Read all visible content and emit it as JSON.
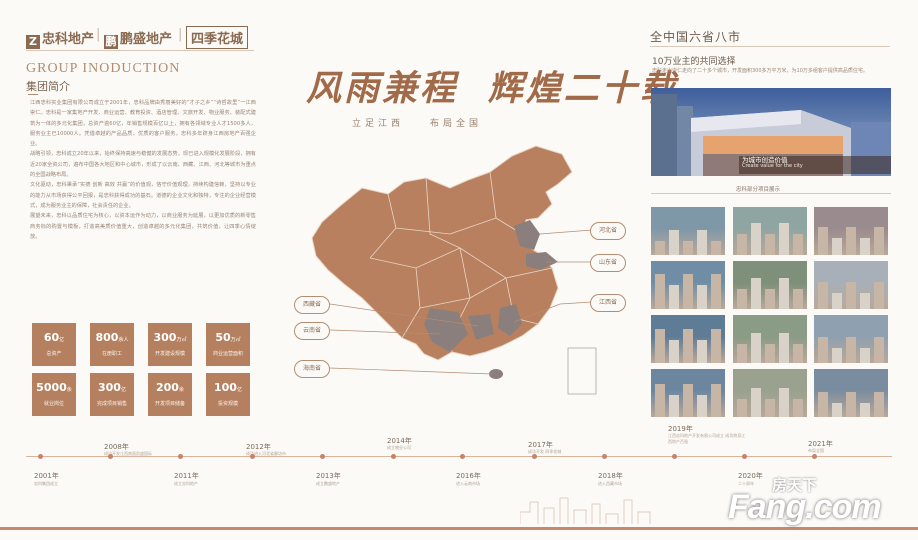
{
  "header": {
    "logos": [
      {
        "mark": "Z",
        "name": "忠科地产"
      },
      {
        "mark": "鹏",
        "name": "鹏盛地产"
      },
      {
        "mark": "",
        "name": "四季花城"
      }
    ]
  },
  "intro": {
    "title_en": "GROUP INODUCTION",
    "title_cn": "集团简介",
    "paragraphs": [
      "江西忠科实业集团有限公司成立于2001年，忠科品牌由秀丽美好的“才子之乡”“诗哲故里”一江西崇仁。忠科是一家集地产开发、商业运营、教育投资、酒店管理、文旅开发、物业服务、装配式建筑为一体的多元化集团，总资产逾60亿，年销售规模百亿以上，拥有各领域专业人才1500多人，服务业主已10000人。凭借卓越的产品品质、优质的客户服务，忠科多年跻身江西房地产百强企业。",
      "战略引领，忠科成立20年以来，始终保持高速与稳健的发展态势，现已进入规模化发展阶段，拥有近20家全资公司，遍布中国各大地区和中心城市，形成了以云南、西藏、江西、河北等城市为重点的全国战略布局。",
      "文化驱动，忠科秉承“实德 创新 高效 共赢”的价值观，恪守价值观理，持续构建信赖，坚持以专业的能力从市场获得公平回报，是忠科获得成功的基石。道德的企业文化和独特，专注的企业经营模式，成为服务业主的保障，社会责任的企业。",
      "展望未来，忠科以品质住宅为核心，以资本运作为动力，以商业服务为延展，以更加优质的新零售商务标的购置与模板，打造高美质价值重大，创造卓越的多元化集团，共筑价值，让四季心情绽放。"
    ],
    "stats": [
      {
        "num": "60",
        "unit": "亿",
        "label": "总资产"
      },
      {
        "num": "800",
        "unit": "余人",
        "label": "在册职工"
      },
      {
        "num": "300",
        "unit": "万㎡",
        "label": "开发建设规模"
      },
      {
        "num": "50",
        "unit": "万㎡",
        "label": "商业运营面积"
      },
      {
        "num": "5000",
        "unit": "余",
        "label": "就业岗位"
      },
      {
        "num": "300",
        "unit": "亿",
        "label": "完成项目销售"
      },
      {
        "num": "200",
        "unit": "余",
        "label": "开发项目储备"
      },
      {
        "num": "100",
        "unit": "亿",
        "label": "投资规模"
      }
    ]
  },
  "center": {
    "slogan_part1": "风雨兼程",
    "slogan_part2": "辉煌二十载",
    "subslogan": "立足江西　　布局全国",
    "provinces": {
      "hebei": "河北省",
      "shandong": "山东省",
      "jiangxi": "江西省",
      "xizang": "西藏省",
      "yunnan": "云南省",
      "hainan": "海南省"
    }
  },
  "right": {
    "title": "全中国六省八市",
    "subtitle": "10万业主的共同选择",
    "desc": "忠科走出崇仁走向了二十多个城市，开发面积300多万平方米，为10万多组客户提供高品质住宅。",
    "photo_caption_cn": "为城市创造价值",
    "photo_caption_en": "Create value for the city",
    "gallery_caption": "忠科部分项目展示",
    "thumb_colors": [
      "#7f98a8",
      "#8fa5a2",
      "#9a8b8e",
      "#6f8ea6",
      "#7e8f7a",
      "#a7b0b8",
      "#5f7c96",
      "#8a9b86",
      "#8fa0b0",
      "#6d86a0",
      "#9aa18f",
      "#7a8da0"
    ]
  },
  "timeline": {
    "top": [
      {
        "year": "2008年",
        "desc": "成功开发江西南昌凯盛国际"
      },
      {
        "year": "2012年",
        "desc": "成功进入河北省廊坊市"
      },
      {
        "year": "2014年",
        "desc": "成立物业公司"
      },
      {
        "year": "2017年",
        "desc": "成功开发 四季花城"
      },
      {
        "year": "2019年",
        "desc": "江西忠科地产开发有限公司成立 成功跻身江西地产百强"
      },
      {
        "year": "2021年",
        "desc": "布局全国"
      }
    ],
    "bottom": [
      {
        "year": "2001年",
        "desc": "忠科集团成立"
      },
      {
        "year": "2011年",
        "desc": "成立忠科地产"
      },
      {
        "year": "2013年",
        "desc": "成立鹏盛地产"
      },
      {
        "year": "2016年",
        "desc": "进入云南市场"
      },
      {
        "year": "2018年",
        "desc": "进入西藏市场"
      },
      {
        "year": "2020年",
        "desc": "二十周年"
      }
    ]
  },
  "watermark": {
    "top": "房天下",
    "bottom": "Fang.com"
  }
}
